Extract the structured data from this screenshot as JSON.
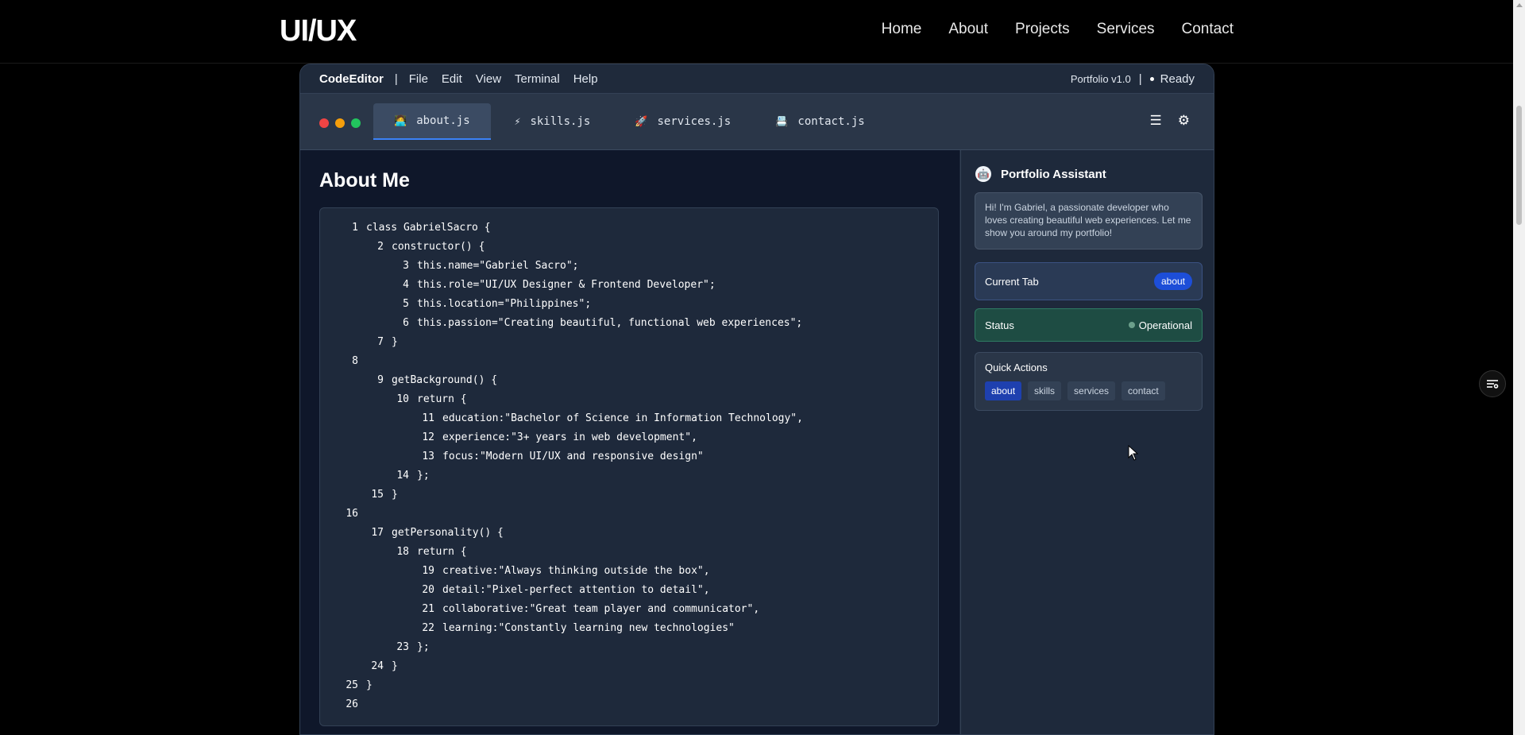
{
  "nav": {
    "logo": "UI/UX",
    "links": [
      "Home",
      "About",
      "Projects",
      "Services",
      "Contact"
    ]
  },
  "editor": {
    "app_name": "CodeEditor",
    "separator": "|",
    "menu": [
      "File",
      "Edit",
      "View",
      "Terminal",
      "Help"
    ],
    "version": "Portfolio v1.0",
    "status": "Ready",
    "traffic_colors": [
      "#ef4444",
      "#f59e0b",
      "#22c55e"
    ],
    "accent": "#3b82f6",
    "tabs": [
      {
        "icon": "🧑‍💻",
        "label": "about.js",
        "active": true
      },
      {
        "icon": "⚡",
        "label": "skills.js",
        "active": false
      },
      {
        "icon": "🚀",
        "label": "services.js",
        "active": false
      },
      {
        "icon": "📇",
        "label": "contact.js",
        "active": false
      }
    ],
    "tools": {
      "menu_icon": "☰",
      "settings_icon": "⚙"
    }
  },
  "content": {
    "title": "About Me",
    "code": [
      {
        "n": "1",
        "indent": 0,
        "text": "class GabrielSacro {"
      },
      {
        "n": "2",
        "indent": 1,
        "text": "constructor() {"
      },
      {
        "n": "3",
        "indent": 2,
        "text": "this.name=\"Gabriel Sacro\";"
      },
      {
        "n": "4",
        "indent": 2,
        "text": "this.role=\"UI/UX Designer & Frontend Developer\";"
      },
      {
        "n": "5",
        "indent": 2,
        "text": "this.location=\"Philippines\";"
      },
      {
        "n": "6",
        "indent": 2,
        "text": "this.passion=\"Creating beautiful, functional web experiences\";"
      },
      {
        "n": "7",
        "indent": 1,
        "text": "}"
      },
      {
        "n": "8",
        "indent": 0,
        "text": ""
      },
      {
        "n": "9",
        "indent": 1,
        "text": "getBackground() {"
      },
      {
        "n": "10",
        "indent": 1,
        "text": "return {"
      },
      {
        "n": "11",
        "indent": 2,
        "text": "education:\"Bachelor of Science in Information Technology\","
      },
      {
        "n": "12",
        "indent": 2,
        "text": "experience:\"3+ years in web development\","
      },
      {
        "n": "13",
        "indent": 2,
        "text": "focus:\"Modern UI/UX and responsive design\""
      },
      {
        "n": "14",
        "indent": 1,
        "text": "};"
      },
      {
        "n": "15",
        "indent": 0,
        "text": "}"
      },
      {
        "n": "16",
        "indent": 0,
        "text": ""
      },
      {
        "n": "17",
        "indent": 0,
        "text": "getPersonality() {"
      },
      {
        "n": "18",
        "indent": 1,
        "text": "return {"
      },
      {
        "n": "19",
        "indent": 2,
        "text": "creative:\"Always thinking outside the box\","
      },
      {
        "n": "20",
        "indent": 2,
        "text": "detail:\"Pixel-perfect attention to detail\","
      },
      {
        "n": "21",
        "indent": 2,
        "text": "collaborative:\"Great team player and communicator\","
      },
      {
        "n": "22",
        "indent": 2,
        "text": "learning:\"Constantly learning new technologies\""
      },
      {
        "n": "23",
        "indent": 1,
        "text": "};"
      },
      {
        "n": "24",
        "indent": 0,
        "text": "}"
      },
      {
        "n": "25",
        "indent": 0,
        "text": "}"
      },
      {
        "n": "26",
        "indent": 0,
        "text": ""
      }
    ]
  },
  "assistant": {
    "title": "Portfolio Assistant",
    "avatar_icon": "robot-icon",
    "message": "Hi! I'm Gabriel, a passionate developer who loves creating beautiful web experiences. Let me show you around my portfolio!",
    "current_tab_label": "Current Tab",
    "current_tab_value": "about",
    "status_label": "Status",
    "status_value": "Operational",
    "quick_actions_label": "Quick Actions",
    "quick_actions": [
      "about",
      "skills",
      "services",
      "contact"
    ]
  }
}
